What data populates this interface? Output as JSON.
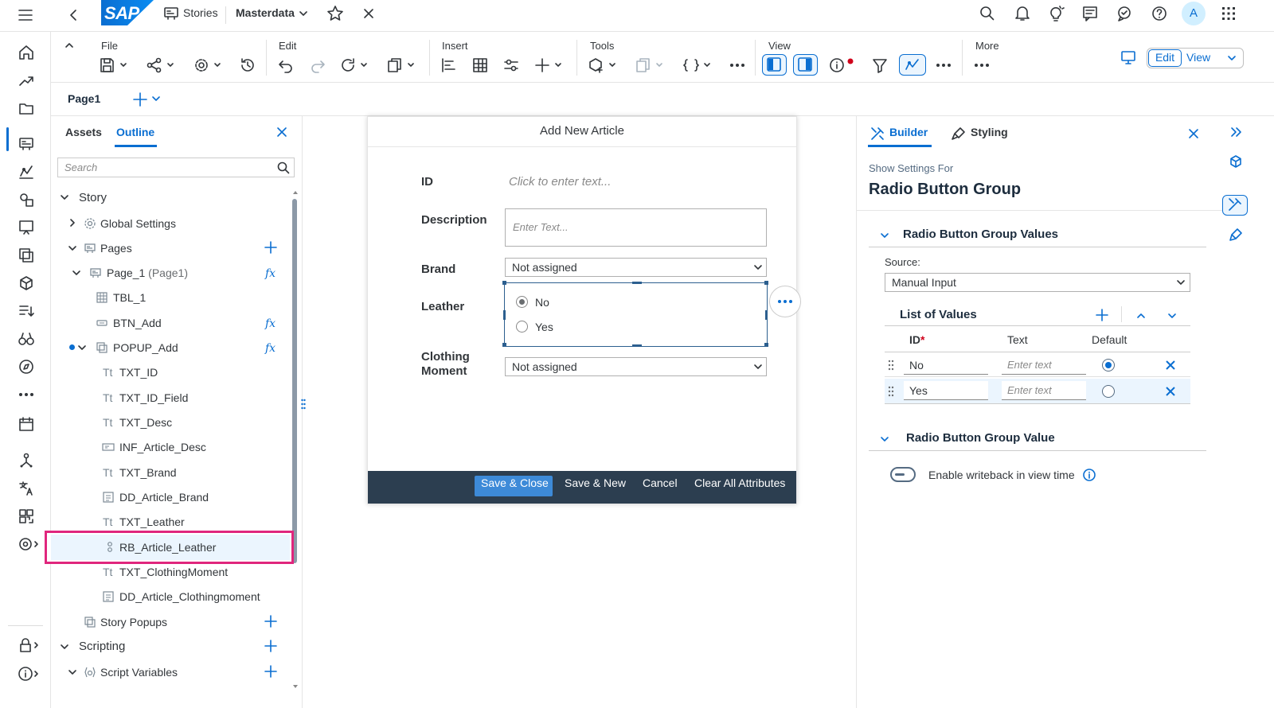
{
  "shell": {
    "logo": "SAP",
    "stories_label": "Stories",
    "story_title": "Masterdata",
    "avatar_initial": "A"
  },
  "toolbar": {
    "groups": {
      "file": "File",
      "edit": "Edit",
      "insert": "Insert",
      "tools": "Tools",
      "view": "View",
      "more": "More"
    },
    "edit_mode": "Edit",
    "view_mode": "View"
  },
  "page_tab": "Page1",
  "outline_panel": {
    "tab_assets": "Assets",
    "tab_outline": "Outline",
    "search_placeholder": "Search",
    "tree": {
      "story": "Story",
      "global_settings": "Global Settings",
      "pages": "Pages",
      "page_1": "Page_1",
      "page_1_alias": "(Page1)",
      "tbl_1": "TBL_1",
      "btn_add": "BTN_Add",
      "popup_add": "POPUP_Add",
      "txt_id": "TXT_ID",
      "txt_id_field": "TXT_ID_Field",
      "txt_desc": "TXT_Desc",
      "inf_article_desc": "INF_Article_Desc",
      "txt_brand": "TXT_Brand",
      "dd_article_brand": "DD_Article_Brand",
      "txt_leather": "TXT_Leather",
      "rb_article_leather": "RB_Article_Leather",
      "txt_clothingmoment": "TXT_ClothingMoment",
      "dd_article_clothingmoment": "DD_Article_Clothingmoment",
      "story_popups": "Story Popups",
      "scripting": "Scripting",
      "script_variables": "Script Variables"
    },
    "text_prefix": "Tt"
  },
  "popup": {
    "title": "Add New Article",
    "id_label": "ID",
    "id_placeholder": "Click to enter text...",
    "description_label": "Description",
    "description_placeholder": "Enter Text...",
    "brand_label": "Brand",
    "brand_value": "Not assigned",
    "leather_label": "Leather",
    "leather_options": [
      "No",
      "Yes"
    ],
    "clothing_label_1": "Clothing",
    "clothing_label_2": "Moment",
    "clothing_value": "Not assigned",
    "footer": {
      "save_close": "Save & Close",
      "save_new": "Save & New",
      "cancel": "Cancel",
      "clear": "Clear All Attributes"
    }
  },
  "builder": {
    "tab_builder": "Builder",
    "tab_styling": "Styling",
    "show_settings_for": "Show Settings For",
    "component_title": "Radio Button Group",
    "section_values": "Radio Button Group Values",
    "source_label": "Source:",
    "source_value": "Manual Input",
    "list_title": "List of Values",
    "col_id": "ID",
    "col_required": "*",
    "col_text": "Text",
    "col_default": "Default",
    "rows": [
      {
        "id": "No",
        "text_placeholder": "Enter text",
        "default": true
      },
      {
        "id": "Yes",
        "text_placeholder": "Enter text",
        "default": false
      }
    ],
    "section_value": "Radio Button Group Value",
    "writeback_label": "Enable writeback in view time"
  },
  "colors": {
    "accent": "#0a6ed1",
    "highlight": "#e0267d",
    "footer_bg": "#2c3e50",
    "selected_row": "#ebf5fe"
  }
}
